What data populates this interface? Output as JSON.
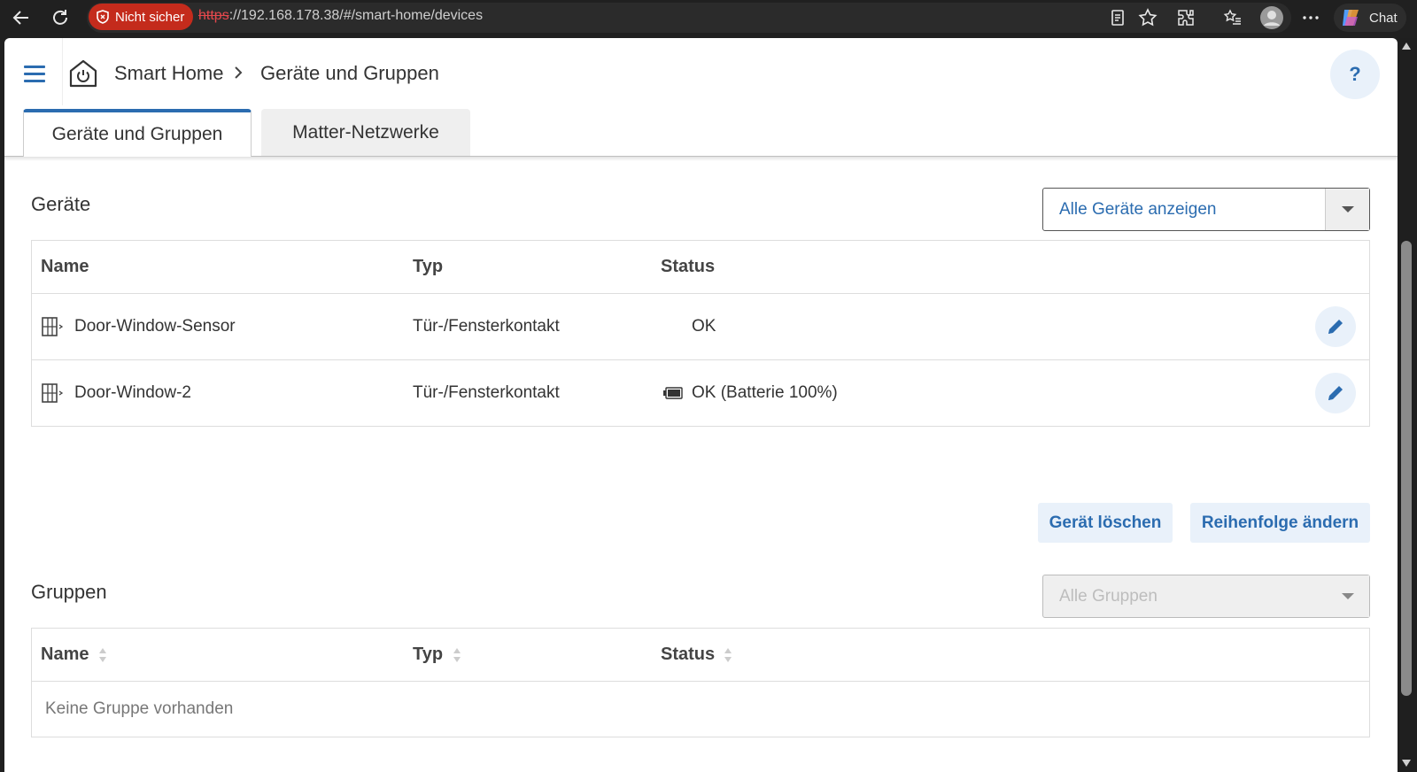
{
  "browser": {
    "security_label": "Nicht sicher",
    "url_scheme": "https",
    "url_rest": "://192.168.178.38/#/smart-home/devices",
    "chat_label": "Chat"
  },
  "header": {
    "breadcrumb_root": "Smart Home",
    "breadcrumb_current": "Geräte und Gruppen",
    "help_label": "?"
  },
  "tabs": [
    {
      "label": "Geräte und Gruppen",
      "active": true
    },
    {
      "label": "Matter-Netzwerke",
      "active": false
    }
  ],
  "devices": {
    "title": "Geräte",
    "filter_value": "Alle Geräte anzeigen",
    "columns": [
      "Name",
      "Typ",
      "Status"
    ],
    "rows": [
      {
        "name": "Door-Window-Sensor",
        "type": "Tür-/Fensterkontakt",
        "status": "OK",
        "battery_icon": false
      },
      {
        "name": "Door-Window-2",
        "type": "Tür-/Fensterkontakt",
        "status": "OK (Batterie 100%)",
        "battery_icon": true
      }
    ],
    "delete_label": "Gerät löschen",
    "reorder_label": "Reihenfolge ändern"
  },
  "groups": {
    "title": "Gruppen",
    "filter_value": "Alle Gruppen",
    "columns": [
      "Name",
      "Typ",
      "Status"
    ],
    "empty_text": "Keine Gruppe vorhanden"
  },
  "colors": {
    "accent": "#2b6cb0",
    "accent_light": "#e9f1fa",
    "insecure": "#c42b1c"
  }
}
